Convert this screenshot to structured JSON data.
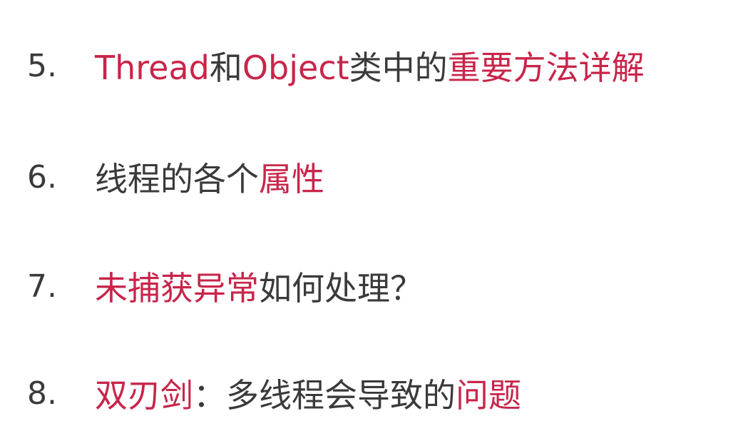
{
  "items": [
    {
      "number": "5.",
      "segments": [
        {
          "text": "Thread",
          "style": "red"
        },
        {
          "text": "和",
          "style": "dark"
        },
        {
          "text": "Object",
          "style": "red"
        },
        {
          "text": "类中的",
          "style": "dark"
        },
        {
          "text": "重要方法详解",
          "style": "red"
        }
      ]
    },
    {
      "number": "6.",
      "segments": [
        {
          "text": "线程的各个",
          "style": "dark"
        },
        {
          "text": "属性",
          "style": "red"
        }
      ]
    },
    {
      "number": "7.",
      "segments": [
        {
          "text": "未捕获异常",
          "style": "red"
        },
        {
          "text": "如何处理？",
          "style": "dark"
        }
      ]
    },
    {
      "number": "8.",
      "segments": [
        {
          "text": "双刃剑",
          "style": "red"
        },
        {
          "text": "：多线程会导致的",
          "style": "dark"
        },
        {
          "text": "问题",
          "style": "red"
        }
      ]
    }
  ],
  "colors": {
    "text_dark": "#3a3a3a",
    "accent_red": "#c8254a",
    "background": "#ffffff"
  }
}
